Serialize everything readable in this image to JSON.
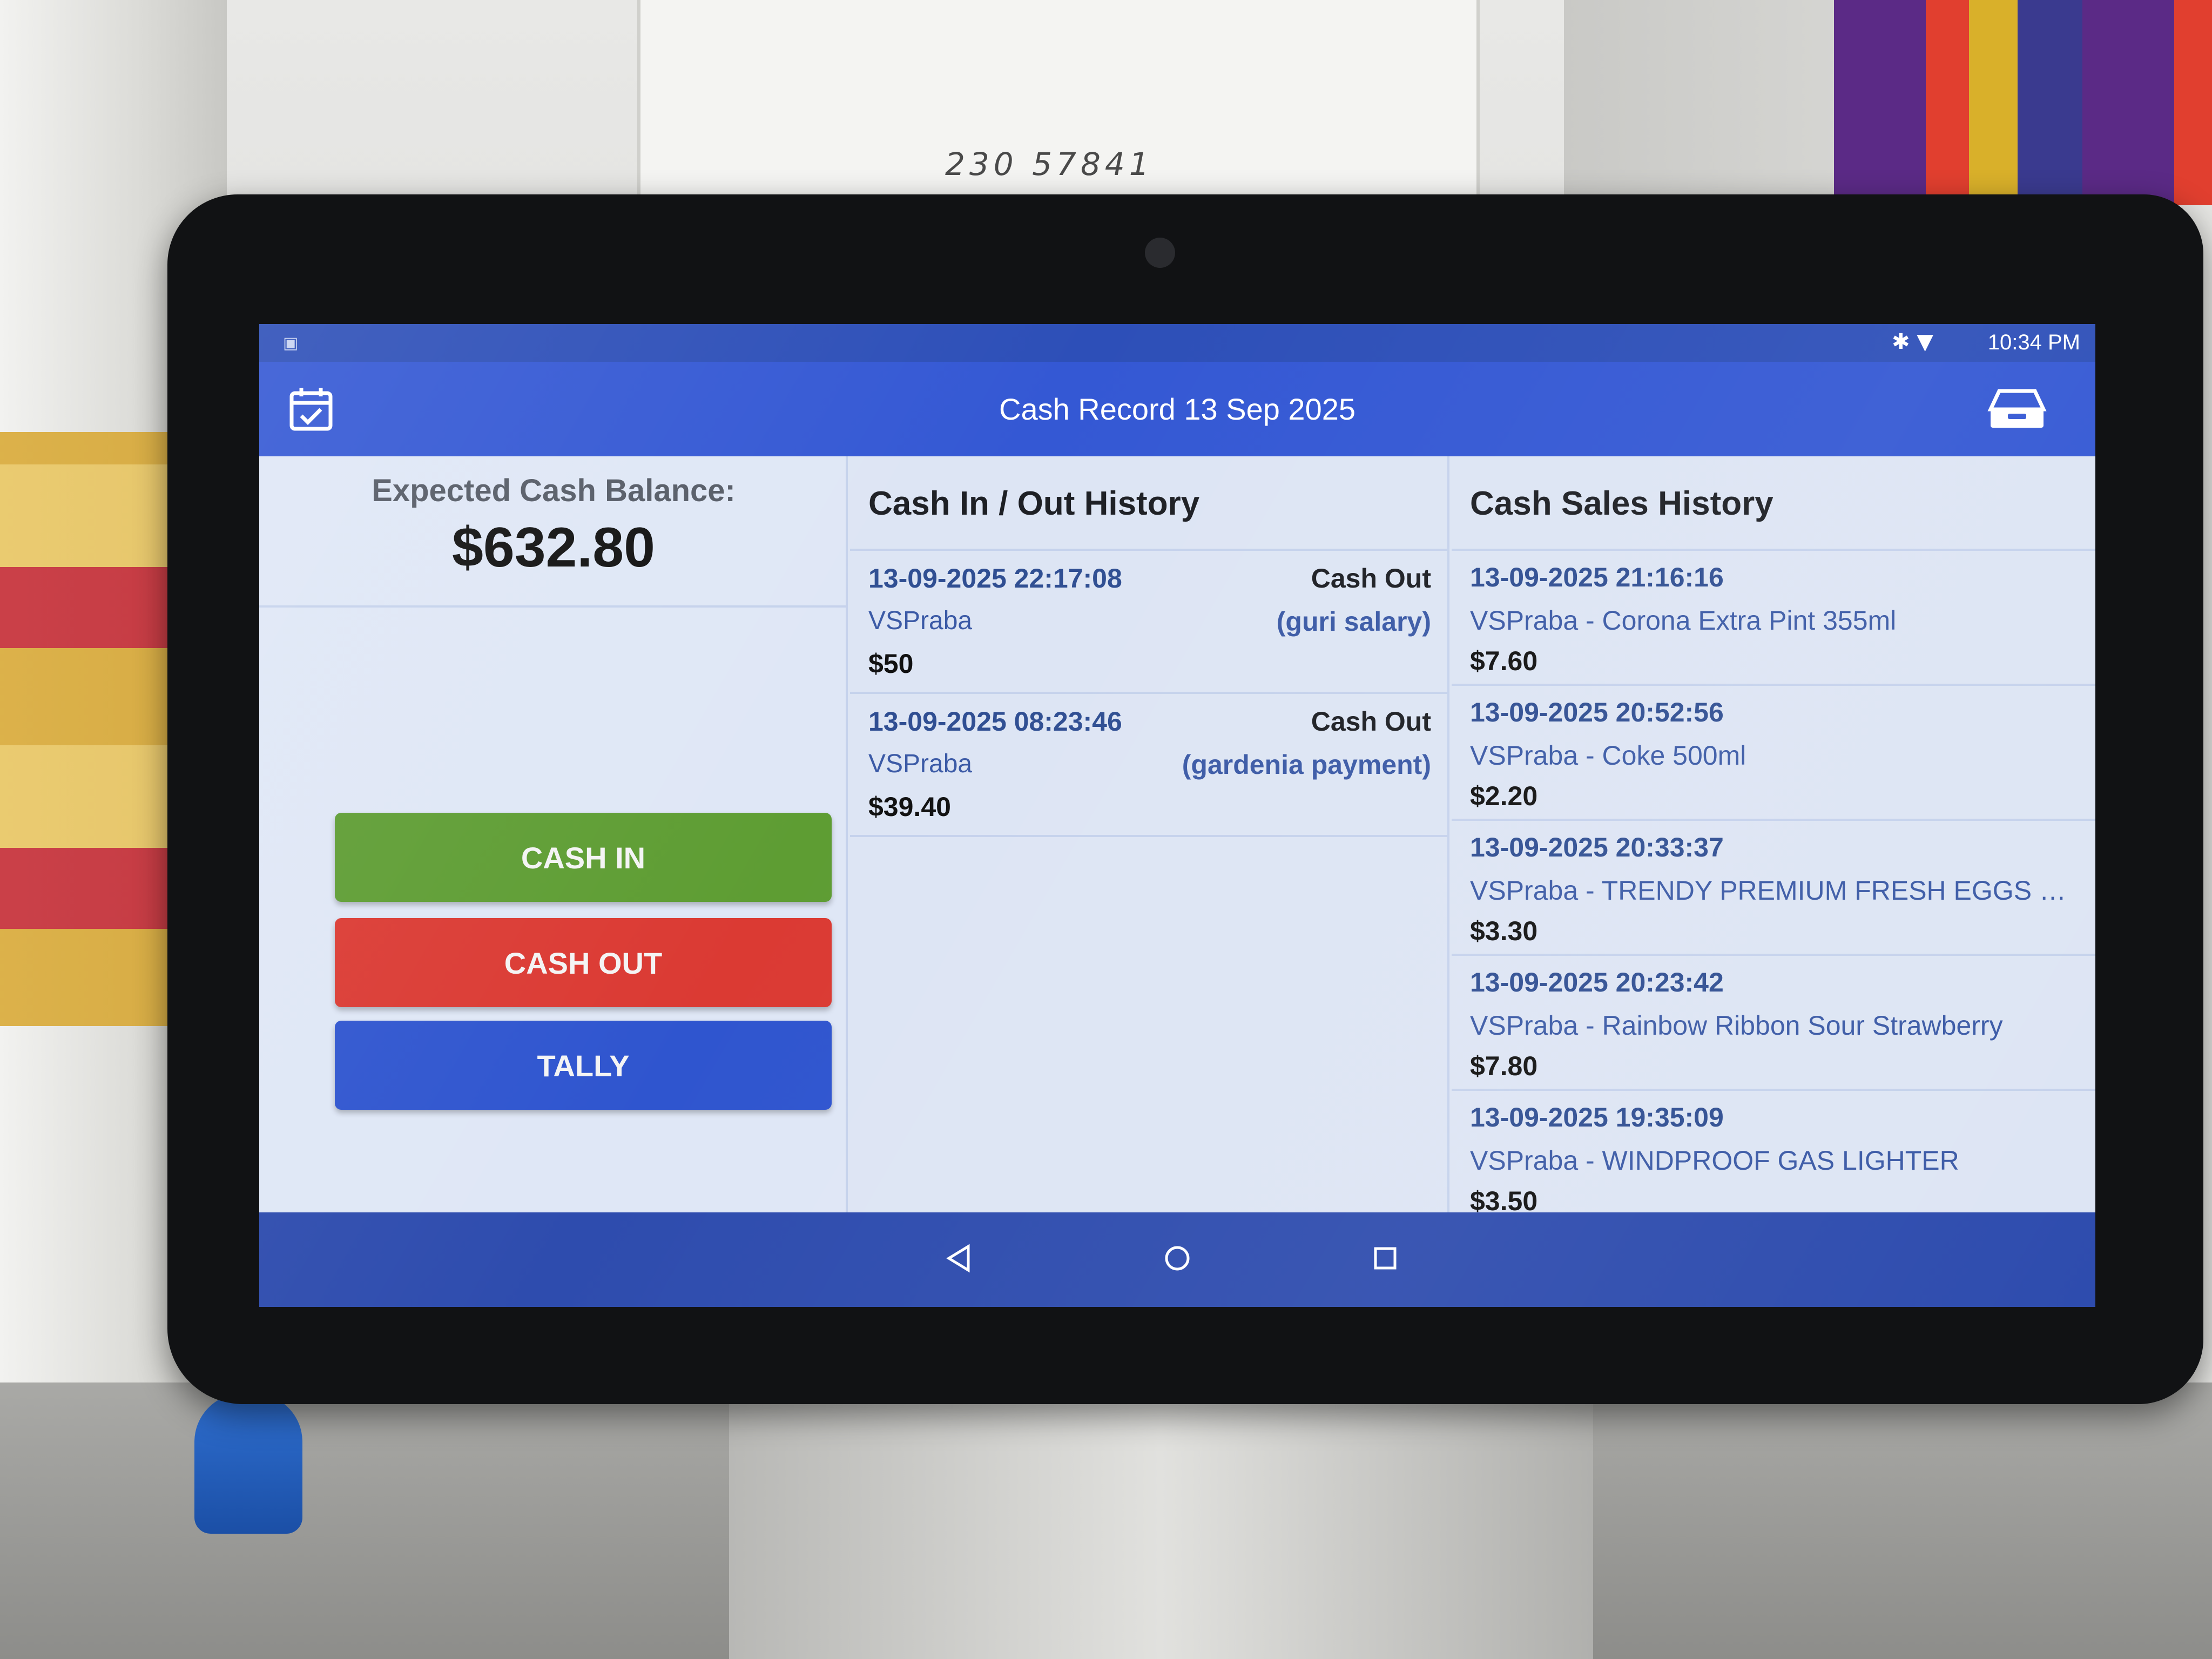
{
  "photo": {
    "paper_number": "230 57841"
  },
  "status_bar": {
    "time": "10:34 PM",
    "icons": [
      "bluetooth-icon",
      "wifi-icon"
    ]
  },
  "app_bar": {
    "title": "Cash Record 13 Sep 2025",
    "left_icon": "calendar-check-icon",
    "right_icon": "cash-drawer-icon"
  },
  "balance": {
    "label": "Expected Cash Balance:",
    "value": "$632.80"
  },
  "actions": {
    "cash_in": "CASH IN",
    "cash_out": "CASH OUT",
    "tally": "TALLY"
  },
  "cash_in_out": {
    "header": "Cash In / Out History",
    "entries": [
      {
        "datetime": "13-09-2025 22:17:08",
        "type": "Cash Out",
        "user": "VSPraba",
        "note": "(guri salary)",
        "amount": "$50"
      },
      {
        "datetime": "13-09-2025 08:23:46",
        "type": "Cash Out",
        "user": "VSPraba",
        "note": "(gardenia payment)",
        "amount": "$39.40"
      }
    ]
  },
  "cash_sales": {
    "header": "Cash Sales History",
    "entries": [
      {
        "datetime": "13-09-2025 21:16:16",
        "desc": "VSPraba - Corona Extra Pint 355ml",
        "amount": "$7.60"
      },
      {
        "datetime": "13-09-2025 20:52:56",
        "desc": "VSPraba - Coke 500ml",
        "amount": "$2.20"
      },
      {
        "datetime": "13-09-2025 20:33:37",
        "desc": "VSPraba - TRENDY PREMIUM FRESH EGGS 1...",
        "amount": "$3.30"
      },
      {
        "datetime": "13-09-2025 20:23:42",
        "desc": "VSPraba - Rainbow Ribbon Sour Strawberry",
        "amount": "$7.80"
      },
      {
        "datetime": "13-09-2025 19:35:09",
        "desc": "VSPraba - WINDPROOF GAS LIGHTER",
        "amount": "$3.50"
      }
    ]
  },
  "nav": {
    "buttons": [
      "back-icon",
      "home-icon",
      "recent-apps-icon"
    ]
  },
  "colors": {
    "app_bar": "#3458d4",
    "cash_in": "#5e9d33",
    "cash_out": "#db3a33",
    "tally": "#2f55cf"
  }
}
